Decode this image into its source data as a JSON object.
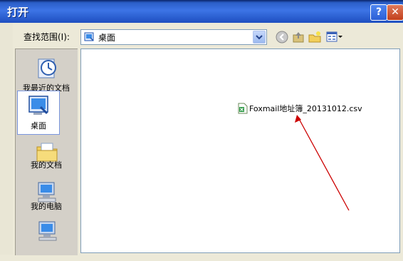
{
  "window": {
    "title": "打开",
    "help_label": "?",
    "close_label": "✕"
  },
  "toolbar": {
    "lookin_label": "查找范围(I):",
    "lookin_value": "桌面",
    "icons": [
      "back-icon",
      "up-folder-icon",
      "new-folder-icon",
      "view-menu-icon"
    ]
  },
  "places": [
    {
      "label": "我最近的文档",
      "icon": "recent-documents-icon"
    },
    {
      "label": "桌面",
      "icon": "desktop-icon",
      "selected": true
    },
    {
      "label": "我的文档",
      "icon": "my-documents-icon"
    },
    {
      "label": "我的电脑",
      "icon": "my-computer-icon"
    },
    {
      "label": "",
      "icon": "network-places-icon"
    }
  ],
  "files": [
    {
      "name": "Foxmail地址簿_20131012.csv",
      "icon": "csv-file-icon"
    }
  ],
  "annotation": {
    "type": "arrow",
    "color": "#cc0000"
  }
}
